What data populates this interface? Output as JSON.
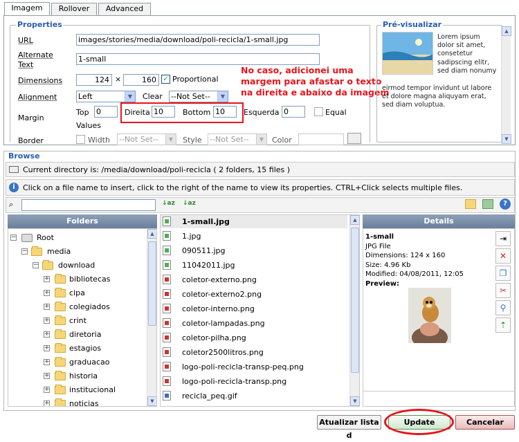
{
  "tabs": [
    "Imagem",
    "Rollover",
    "Advanced"
  ],
  "properties": {
    "legend": "Properties",
    "url_label": "URL",
    "url_value": "images/stories/media/download/poli-recicla/1-small.jpg",
    "alt_label_1": "Alternate",
    "alt_label_2": "Text",
    "alt_value": "1-small",
    "dimensions_label": "Dimensions",
    "width_value": "124",
    "times": "×",
    "height_value": "160",
    "proportional_label": "Proportional",
    "proportional_checked": "✓",
    "alignment_label": "Alignment",
    "alignment_value": "Left",
    "clear_label": "Clear",
    "clear_value": "--Not Set--",
    "margin_label": "Margin",
    "top_label": "Top",
    "top_value": "0",
    "direita_label": "Direita",
    "direita_value": "10",
    "bottom_label": "Bottom",
    "bottom_value": "10",
    "esquerda_label": "Esquerda",
    "esquerda_value": "0",
    "equal_label": "Equal",
    "values_label": "Values",
    "border_label": "Border",
    "border_width_label": "Width",
    "border_width_value": "--Not Set--",
    "border_style_label": "Style",
    "border_style_value": "--Not Set--",
    "border_color_label": "Color"
  },
  "annotation": "No caso, adicionei uma\nmargem para afastar o texto\nna direita e abaixo da imagem",
  "preview": {
    "legend": "Pré-visualizar",
    "text_wrap": "Lorem ipsum dolor sit amet, consetetur sadipscing elitr, sed diam nonumy",
    "text_below": "eirmod tempor invidunt ut labore et dolore magna aliquyam erat, sed diam voluptua."
  },
  "browse": {
    "legend": "Browse",
    "current_dir": "Current directory is: /media/download/poli-recicla ( 2 folders, 15 files )",
    "info": "Click on a file name to insert, click to the right of the name to view its properties. CTRL+Click selects multiple files.",
    "search_value": ""
  },
  "folders": {
    "header": "Folders",
    "root": "Root",
    "media": "media",
    "download": "download",
    "items": [
      "bibliotecas",
      "cipa",
      "colegiados",
      "crint",
      "diretoria",
      "estagios",
      "graduacao",
      "historia",
      "institucional",
      "noticias"
    ]
  },
  "files": [
    {
      "name": "1-small.jpg",
      "type": "jpg"
    },
    {
      "name": "1.jpg",
      "type": "jpg"
    },
    {
      "name": "090511.jpg",
      "type": "jpg"
    },
    {
      "name": "11042011.jpg",
      "type": "jpg"
    },
    {
      "name": "coletor-externo.png",
      "type": "png"
    },
    {
      "name": "coletor-externo2.png",
      "type": "png"
    },
    {
      "name": "coletor-interno.png",
      "type": "png"
    },
    {
      "name": "coletor-lampadas.png",
      "type": "png"
    },
    {
      "name": "coletor-pilha.png",
      "type": "png"
    },
    {
      "name": "coletor2500litros.png",
      "type": "png"
    },
    {
      "name": "logo-poli-recicla-transp-peq.png",
      "type": "png"
    },
    {
      "name": "logo-poli-recicla-transp.png",
      "type": "png"
    },
    {
      "name": "recicla_peq.gif",
      "type": "gif"
    }
  ],
  "details": {
    "header": "Details",
    "name": "1-small",
    "type": "JPG File",
    "dimensions": "Dimensions: 124 x 160",
    "size": "Size: 4.96 Kb",
    "modified": "Modified: 04/08/2011, 12:05",
    "preview": "Preview:"
  },
  "buttons": {
    "refresh": "Atualizar lista d",
    "update": "Update",
    "cancel": "Cancelar"
  },
  "colors": {
    "accent": "#2a5db0",
    "annotation": "#e8141b",
    "highlight": "#e8141b"
  }
}
